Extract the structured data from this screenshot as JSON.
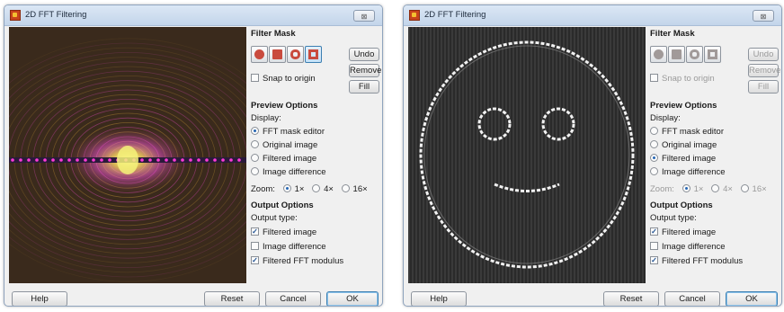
{
  "windows": [
    {
      "title": "2D FFT Filtering",
      "close_label": "⊠",
      "preview": {
        "kind": "fft-spectrum",
        "colors": {
          "bg": "#3a2a1c",
          "ring": "#d4a03a",
          "glow": "#ff4fd8",
          "center": "#f0f070",
          "line": "#ff3ad6"
        }
      },
      "filter_mask": {
        "title": "Filter Mask",
        "tools": [
          "circle-mask-icon",
          "rectangle-mask-icon",
          "round-frame-mask-icon",
          "rect-frame-mask-icon"
        ],
        "selected_tool": 3,
        "undo": "Undo",
        "remove": "Remove",
        "fill": "Fill",
        "snap": "Snap to origin",
        "snap_checked": false,
        "disabled": false
      },
      "preview_options": {
        "title": "Preview Options",
        "display_label": "Display:",
        "display": [
          "FFT mask editor",
          "Original image",
          "Filtered image",
          "Image difference"
        ],
        "display_selected": 0,
        "zoom_label": "Zoom:",
        "zoom": [
          "1×",
          "4×",
          "16×"
        ],
        "zoom_selected": 0,
        "zoom_disabled": false
      },
      "output_options": {
        "title": "Output Options",
        "type_label": "Output type:",
        "items": [
          {
            "label": "Filtered image",
            "checked": true
          },
          {
            "label": "Image difference",
            "checked": false
          },
          {
            "label": "Filtered FFT modulus",
            "checked": true
          }
        ]
      },
      "buttons": {
        "help": "Help",
        "reset": "Reset",
        "cancel": "Cancel",
        "ok": "OK"
      }
    },
    {
      "title": "2D FFT Filtering",
      "close_label": "⊠",
      "preview": {
        "kind": "smiley",
        "colors": {
          "bg": "#2a2a2a",
          "stripe": "#3a3a3a",
          "face": "#f2f2f2"
        }
      },
      "filter_mask": {
        "title": "Filter Mask",
        "tools": [
          "circle-mask-icon",
          "rectangle-mask-icon",
          "round-frame-mask-icon",
          "rect-frame-mask-icon"
        ],
        "selected_tool": -1,
        "undo": "Undo",
        "remove": "Remove",
        "fill": "Fill",
        "snap": "Snap to origin",
        "snap_checked": false,
        "disabled": true
      },
      "preview_options": {
        "title": "Preview Options",
        "display_label": "Display:",
        "display": [
          "FFT mask editor",
          "Original image",
          "Filtered image",
          "Image difference"
        ],
        "display_selected": 2,
        "zoom_label": "Zoom:",
        "zoom": [
          "1×",
          "4×",
          "16×"
        ],
        "zoom_selected": 0,
        "zoom_disabled": true
      },
      "output_options": {
        "title": "Output Options",
        "type_label": "Output type:",
        "items": [
          {
            "label": "Filtered image",
            "checked": true
          },
          {
            "label": "Image difference",
            "checked": false
          },
          {
            "label": "Filtered FFT modulus",
            "checked": true
          }
        ]
      },
      "buttons": {
        "help": "Help",
        "reset": "Reset",
        "cancel": "Cancel",
        "ok": "OK"
      }
    }
  ]
}
